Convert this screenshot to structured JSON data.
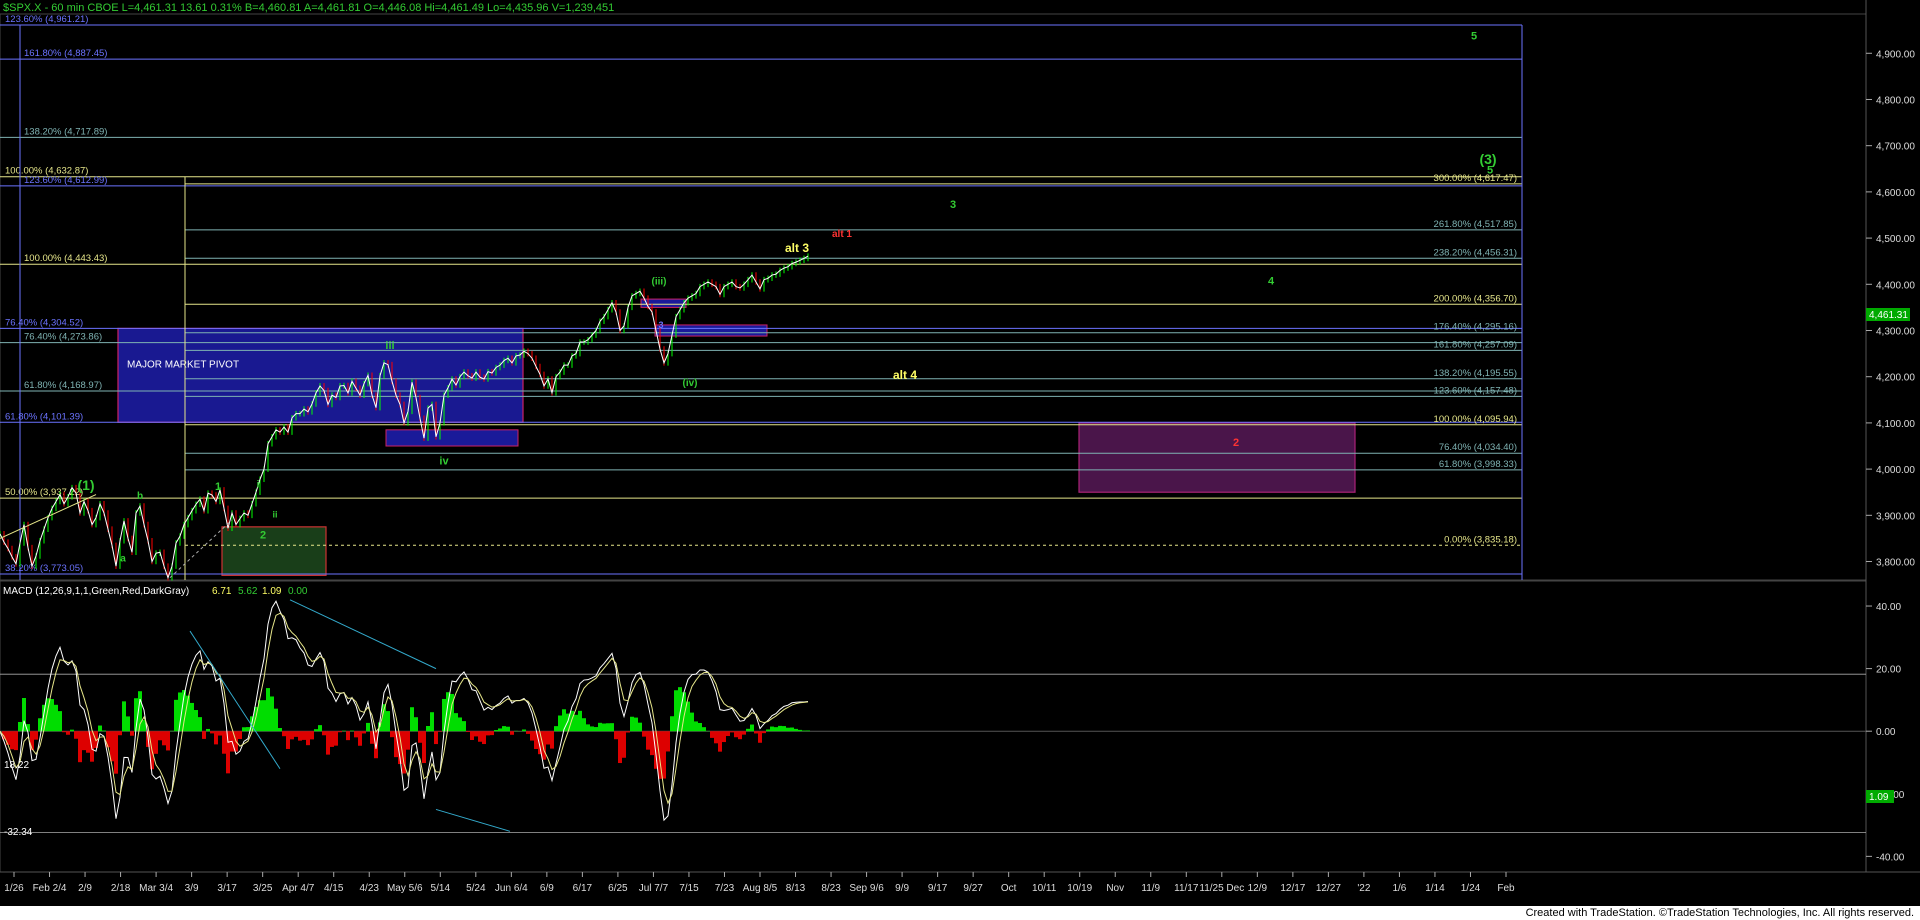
{
  "header": {
    "symbol_line": "$SPX.X - 60 min  CBOE  L=4,461.31  13.61  0.31%    B=4,460.81  A=4,461.81  O=4,446.08  Hi=4,461.49  Lo=4,435.96  V=1,239,451"
  },
  "footer": {
    "credit": "Created with TradeStation. ©TradeStation Technologies, Inc. All rights reserved."
  },
  "colors": {
    "background": "#000000",
    "price_line": "#ffffff",
    "up_candle": "#00ff00",
    "down_candle": "#ff0000",
    "blue_fib": "#6b73ff",
    "yellow_fib": "#e6e68a",
    "teal_fib": "#7fb3b3",
    "wave_green": "#33cc33",
    "wave_yellow": "#ffff66",
    "wave_red": "#ff3333",
    "pivot_box": "#1a1a99",
    "support_box": "#1f4d1f",
    "target_box": "#5c1a5c"
  },
  "chart_data": [
    {
      "type": "line",
      "panel": "price",
      "title": "$SPX.X - 60 min",
      "yticks": [
        "4,900.00",
        "4,800.00",
        "4,700.00",
        "4,600.00",
        "4,500.00",
        "4,400.00",
        "4,300.00",
        "4,200.00",
        "4,100.00",
        "4,000.00",
        "3,900.00",
        "3,800.00"
      ],
      "ylim": [
        3760,
        4985
      ],
      "last_price_label": "4,461.31",
      "x_labels": [
        "1/26",
        "Feb 2/4",
        "2/9",
        "2/18",
        "Mar 3/4",
        "3/9",
        "3/17",
        "3/25",
        "Apr 4/7",
        "4/15",
        "4/23",
        "May 5/6",
        "5/14",
        "5/24",
        "Jun 6/4",
        "6/9",
        "6/17",
        "6/25",
        "Jul 7/7",
        "7/15",
        "7/23",
        "Aug 8/5",
        "8/13",
        "8/23",
        "Sep 9/6",
        "9/9",
        "9/17",
        "9/27",
        "Oct",
        "10/11",
        "10/19",
        "Nov",
        "11/9",
        "11/17",
        "11/25 Dec",
        "12/9",
        "12/17",
        "12/27",
        "'22",
        "1/6",
        "1/14",
        "1/24",
        "Feb"
      ],
      "series": [
        {
          "x": [
            0,
            4,
            8,
            12,
            16,
            20,
            24,
            28,
            32,
            36,
            40,
            44,
            48,
            52,
            56,
            60,
            64,
            68,
            72,
            76,
            80,
            84,
            88,
            92,
            96,
            100,
            104,
            108,
            112,
            116,
            120,
            124,
            128,
            132,
            136,
            140,
            144,
            148,
            152,
            156,
            160,
            164,
            168,
            172,
            176,
            180,
            184,
            188,
            192,
            196,
            200,
            204,
            208,
            212,
            216,
            220,
            224,
            228,
            232,
            236,
            240,
            244,
            248,
            252,
            256,
            260,
            264,
            268,
            272,
            276,
            280,
            284,
            288,
            292,
            296,
            300,
            304,
            308,
            312,
            316,
            320,
            324,
            328,
            332,
            336,
            340,
            344,
            348,
            352,
            356,
            360,
            364,
            368,
            372,
            376,
            380,
            384,
            388,
            392,
            396,
            400,
            404,
            408,
            412,
            416,
            420,
            424,
            428,
            432,
            436,
            440,
            444,
            448,
            452,
            456,
            460,
            464,
            468,
            472,
            476,
            480,
            484,
            488,
            492,
            496,
            500,
            504,
            508,
            512,
            516,
            520,
            524,
            528,
            532,
            536,
            540,
            544,
            548,
            552,
            556,
            560,
            564,
            568,
            572,
            576,
            580,
            584,
            588,
            592,
            596,
            600,
            604,
            608,
            612,
            616,
            620,
            624,
            628,
            632,
            636,
            640,
            644,
            648,
            652,
            656,
            660,
            664,
            668,
            672,
            676,
            680,
            684,
            688,
            692,
            696,
            700,
            704,
            708,
            712,
            716,
            720,
            724,
            728,
            732,
            736,
            740,
            744,
            748,
            752,
            756,
            760,
            764,
            768,
            772,
            776,
            780,
            784,
            788,
            792,
            796,
            800,
            804,
            808
          ],
          "y": [
            3860,
            3842,
            3828,
            3810,
            3795,
            3840,
            3880,
            3830,
            3790,
            3812,
            3845,
            3870,
            3895,
            3915,
            3930,
            3945,
            3925,
            3940,
            3960,
            3948,
            3905,
            3930,
            3910,
            3880,
            3895,
            3925,
            3905,
            3870,
            3835,
            3790,
            3845,
            3888,
            3850,
            3820,
            3905,
            3920,
            3880,
            3845,
            3800,
            3818,
            3820,
            3790,
            3765,
            3790,
            3840,
            3855,
            3880,
            3895,
            3910,
            3924,
            3935,
            3910,
            3948,
            3944,
            3930,
            3955,
            3915,
            3872,
            3905,
            3880,
            3893,
            3905,
            3900,
            3925,
            3950,
            3978,
            4000,
            4055,
            4070,
            4085,
            4080,
            4091,
            4080,
            4111,
            4120,
            4120,
            4130,
            4124,
            4141,
            4165,
            4180,
            4170,
            4140,
            4160,
            4155,
            4180,
            4181,
            4165,
            4190,
            4175,
            4160,
            4185,
            4203,
            4160,
            4133,
            4202,
            4230,
            4226,
            4190,
            4160,
            4140,
            4100,
            4125,
            4188,
            4155,
            4110,
            4067,
            4132,
            4140,
            4070,
            4100,
            4160,
            4176,
            4195,
            4182,
            4200,
            4210,
            4202,
            4197,
            4210,
            4199,
            4195,
            4211,
            4208,
            4220,
            4225,
            4235,
            4240,
            4230,
            4245,
            4247,
            4255,
            4250,
            4240,
            4222,
            4205,
            4180,
            4195,
            4165,
            4200,
            4210,
            4225,
            4225,
            4245,
            4250,
            4275,
            4275,
            4280,
            4290,
            4300,
            4320,
            4330,
            4345,
            4360,
            4340,
            4300,
            4310,
            4350,
            4375,
            4380,
            4385,
            4370,
            4352,
            4340,
            4300,
            4260,
            4230,
            4250,
            4290,
            4330,
            4345,
            4360,
            4370,
            4375,
            4380,
            4395,
            4400,
            4405,
            4400,
            4395,
            4378,
            4395,
            4400,
            4405,
            4395,
            4392,
            4400,
            4410,
            4420,
            4405,
            4390,
            4410,
            4413,
            4420,
            4422,
            4430,
            4435,
            4438,
            4445,
            4448,
            4452,
            4456,
            4461
          ],
          "name": ""
        }
      ]
    },
    {
      "type": "line",
      "panel": "indicator",
      "title": "MACD (12,26,9,1,1,Green,Red,DarkGray)",
      "values_label": [
        "6.71",
        "5.62",
        "1.09",
        "0.00"
      ],
      "yticks": [
        "40.00",
        "20.00",
        "0.00",
        "-20.00",
        "-40.00"
      ],
      "ylim": [
        -45,
        48
      ],
      "level_labels": [
        "18.22",
        "-32.34"
      ],
      "last_value_label": "1.09"
    }
  ],
  "fib_levels": [
    {
      "label": "123.60% (4,961.21)",
      "price": 4961.21,
      "side": "left",
      "color": "#6b73ff"
    },
    {
      "label": "161.80% (4,887.45)",
      "price": 4887.45,
      "side": "left",
      "color": "#6b73ff"
    },
    {
      "label": "138.20% (4,717.89)",
      "price": 4717.89,
      "side": "left",
      "color": "#7fb3b3"
    },
    {
      "label": "100.00% (4,632.87)",
      "price": 4632.87,
      "side": "left",
      "color": "#e6e68a"
    },
    {
      "label": "123.60% (4,612.99)",
      "price": 4612.99,
      "side": "left",
      "color": "#6b73ff"
    },
    {
      "label": "100.00% (4,443.43)",
      "price": 4443.43,
      "side": "left",
      "color": "#e6e68a"
    },
    {
      "label": "76.40% (4,304.52)",
      "price": 4304.52,
      "side": "left",
      "color": "#6b73ff"
    },
    {
      "label": "76.40% (4,273.86)",
      "price": 4273.86,
      "side": "left",
      "color": "#7fb3b3"
    },
    {
      "label": "61.80% (4,168.97)",
      "price": 4168.97,
      "side": "left",
      "color": "#7fb3b3"
    },
    {
      "label": "61.80% (4,101.39)",
      "price": 4101.39,
      "side": "left",
      "color": "#6b73ff"
    },
    {
      "label": "50.00% (3,937.22)",
      "price": 3937.22,
      "side": "left",
      "color": "#e6e68a"
    },
    {
      "label": "38.20% (3,773.05)",
      "price": 3773.05,
      "side": "left",
      "color": "#6b73ff"
    },
    {
      "label": "300.00% (4,617.47)",
      "price": 4617.47,
      "side": "right",
      "color": "#e6e68a"
    },
    {
      "label": "261.80% (4,517.85)",
      "price": 4517.85,
      "side": "right",
      "color": "#7fb3b3"
    },
    {
      "label": "238.20% (4,456.31)",
      "price": 4456.31,
      "side": "right",
      "color": "#7fb3b3"
    },
    {
      "label": "200.00% (4,356.70)",
      "price": 4356.7,
      "side": "right",
      "color": "#e6e68a"
    },
    {
      "label": "176.40% (4,295.16)",
      "price": 4295.16,
      "side": "right",
      "color": "#7fb3b3"
    },
    {
      "label": "161.80% (4,257.09)",
      "price": 4257.09,
      "side": "right",
      "color": "#7fb3b3"
    },
    {
      "label": "138.20% (4,195.55)",
      "price": 4195.55,
      "side": "right",
      "color": "#7fb3b3"
    },
    {
      "label": "123.60% (4,157.48)",
      "price": 4157.48,
      "side": "right",
      "color": "#7fb3b3"
    },
    {
      "label": "100.00% (4,095.94)",
      "price": 4095.94,
      "side": "right",
      "color": "#e6e68a"
    },
    {
      "label": "76.40% (4,034.40)",
      "price": 4034.4,
      "side": "right",
      "color": "#7fb3b3"
    },
    {
      "label": "61.80% (3,998.33)",
      "price": 3998.33,
      "side": "right",
      "color": "#7fb3b3"
    },
    {
      "label": "0.00% (3,835.18)",
      "price": 3835.18,
      "side": "right",
      "color": "#e6e68a"
    }
  ],
  "zones": [
    {
      "label": "MAJOR MARKET PIVOT",
      "price_top": 4304.52,
      "price_bottom": 4101.39,
      "color": "#1a1a99"
    },
    {
      "label": "",
      "price_top": 3875,
      "price_bottom": 3770,
      "color": "#1f4d1f"
    },
    {
      "label": "",
      "price_top": 4100,
      "price_bottom": 3950,
      "color": "#5c1a5c"
    }
  ],
  "wave_labels": [
    {
      "text": "(1)",
      "price": 3955,
      "color": "#33cc33"
    },
    {
      "text": "a",
      "price": 3800,
      "color": "#33cc33"
    },
    {
      "text": "b",
      "price": 3935,
      "color": "#33cc33"
    },
    {
      "text": "1",
      "price": 3955,
      "color": "#33cc33"
    },
    {
      "text": "i",
      "price": 3960,
      "color": "#33cc33"
    },
    {
      "text": "ii",
      "price": 3895,
      "color": "#33cc33"
    },
    {
      "text": "2",
      "price": 3850,
      "color": "#33cc33"
    },
    {
      "text": "iii",
      "price": 4260,
      "color": "#33cc33"
    },
    {
      "text": "iv",
      "price": 4010,
      "color": "#33cc33"
    },
    {
      "text": "(iii)",
      "price": 4400,
      "color": "#33cc33"
    },
    {
      "text": "(iv)",
      "price": 4180,
      "color": "#33cc33"
    },
    {
      "text": "alt 3",
      "price": 4470,
      "color": "#ffff66"
    },
    {
      "text": "alt 1",
      "price": 4502,
      "color": "#ff3333"
    },
    {
      "text": "3",
      "price": 4565,
      "color": "#33cc33"
    },
    {
      "text": "4",
      "price": 4400,
      "color": "#33cc33"
    },
    {
      "text": "alt 4",
      "price": 4195,
      "color": "#ffff66"
    },
    {
      "text": "2",
      "price": 4050,
      "color": "#ff3333"
    },
    {
      "text": "(3)",
      "price": 4660,
      "color": "#33cc33"
    },
    {
      "text": "5",
      "price": 4640,
      "color": "#33cc33"
    },
    {
      "text": "5",
      "price": 4930,
      "color": "#33cc33"
    },
    {
      "text": "3",
      "price": 4305,
      "color": "#6b73ff"
    }
  ]
}
